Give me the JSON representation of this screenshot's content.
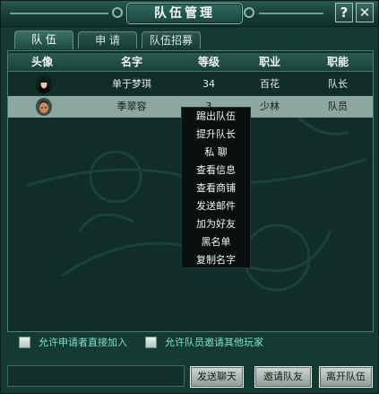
{
  "window": {
    "title": "队伍管理",
    "help_label": "?",
    "close_label": "✕"
  },
  "tabs": [
    {
      "label": "队  伍",
      "active": true
    },
    {
      "label": "申  请",
      "active": false
    },
    {
      "label": "队伍招募",
      "active": false
    }
  ],
  "table": {
    "columns": [
      "头像",
      "名字",
      "等级",
      "职业",
      "职能"
    ],
    "rows": [
      {
        "avatar": "female-character-avatar",
        "name": "单于梦琪",
        "level": "34",
        "class": "百花",
        "role": "队长",
        "selected": false
      },
      {
        "avatar": "male-character-avatar",
        "name": "季翠容",
        "level": "3",
        "class": "少林",
        "role": "队员",
        "selected": true
      }
    ]
  },
  "context_menu": {
    "items": [
      "踢出队伍",
      "提升队长",
      "私  聊",
      "查看信息",
      "查看商铺",
      "发送邮件",
      "加为好友",
      "黑名单",
      "复制名字"
    ]
  },
  "options": {
    "allow_direct_join": "允许申请者直接加入",
    "allow_member_invite": "允许队员邀请其他玩家"
  },
  "buttons": {
    "send_chat": "发送聊天",
    "invite": "邀请队友",
    "leave": "离开队伍"
  },
  "colors": {
    "accent": "#7fe0c9",
    "selected_row": "#8da69f",
    "panel": "#102d28"
  }
}
